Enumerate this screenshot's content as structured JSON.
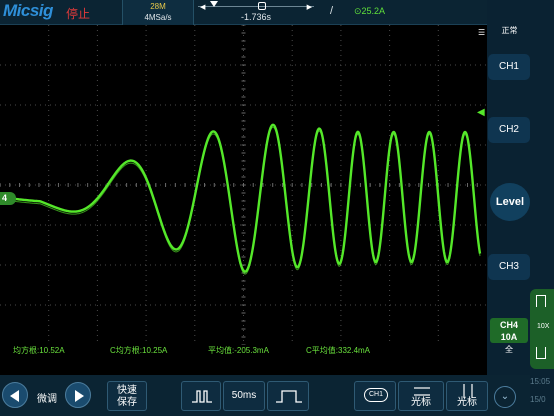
{
  "header": {
    "brand": "Micsig",
    "run_status": "停止",
    "memory_depth": "28M",
    "sample_rate": "4MSa/s",
    "trigger_delay": "-1.736s",
    "trigger_slope": "/",
    "trigger_level": "⊙25.2A"
  },
  "side_panel": {
    "trigger_mode": "正常",
    "ch1_label": "CH1",
    "ch2_label": "CH2",
    "level_label": "Level",
    "ch3_label": "CH3",
    "ch4_name": "CH4",
    "ch4_scale": "10A",
    "ch4_bandwidth": "全",
    "ch4_probe": "10X",
    "clock": "15:05",
    "clock_date": "15/0"
  },
  "channel_marker": {
    "ch4_id": "4"
  },
  "measurements": [
    {
      "label": "均方根:10.52A"
    },
    {
      "label": "C均方根:10.25A"
    },
    {
      "label": "平均值:-205.3mA"
    },
    {
      "label": "C平均值:332.4mA"
    }
  ],
  "bottom_bar": {
    "fine_label": "微调",
    "quick_save": [
      "快速",
      "保存"
    ],
    "timebase": "50ms",
    "ch1_select": "CH1",
    "h_cursor": "光标",
    "v_cursor": "光标"
  },
  "colors": {
    "trace": "#55e82a",
    "grid": "#4a4a4a",
    "accent": "#2e8fd8",
    "stop": "#e23a3a"
  }
}
